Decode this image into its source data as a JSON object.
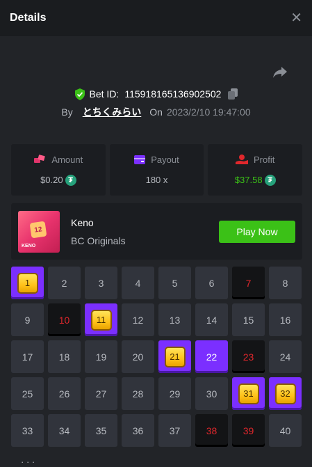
{
  "header": {
    "title": "Details",
    "close_icon": "close-icon"
  },
  "share_icon": "share-icon",
  "bet": {
    "id_label": "Bet ID:",
    "id_value": "115918165136902502",
    "by_label": "By",
    "user": "とちくみらい",
    "on_label": "On",
    "time": "2023/2/10 19:47:00"
  },
  "stats": {
    "amount": {
      "label": "Amount",
      "value": "$0.20"
    },
    "payout": {
      "label": "Payout",
      "value": "180 x"
    },
    "profit": {
      "label": "Profit",
      "value": "$37.58"
    },
    "currency_icon": "tether-coin-icon"
  },
  "game": {
    "name": "Keno",
    "provider": "BC Originals",
    "thumb_number": "12",
    "thumb_label": "KENO",
    "play_label": "Play Now"
  },
  "grid": {
    "numbers": [
      "1",
      "2",
      "3",
      "4",
      "5",
      "6",
      "7",
      "8",
      "9",
      "10",
      "11",
      "12",
      "13",
      "14",
      "15",
      "16",
      "17",
      "18",
      "19",
      "20",
      "21",
      "22",
      "23",
      "24",
      "25",
      "26",
      "27",
      "28",
      "29",
      "30",
      "31",
      "32",
      "33",
      "34",
      "35",
      "36",
      "37",
      "38",
      "39",
      "40"
    ],
    "hits": [
      "1",
      "11",
      "21",
      "31",
      "32"
    ],
    "picks_not_drawn": [
      "22"
    ],
    "drawn_not_picked": [
      "7",
      "10",
      "23",
      "38",
      "39"
    ]
  },
  "colors": {
    "accent_green": "#3bc117",
    "pick_purple": "#7b2fff",
    "miss_red": "#e0272c"
  },
  "footer_partial": "· · ·"
}
